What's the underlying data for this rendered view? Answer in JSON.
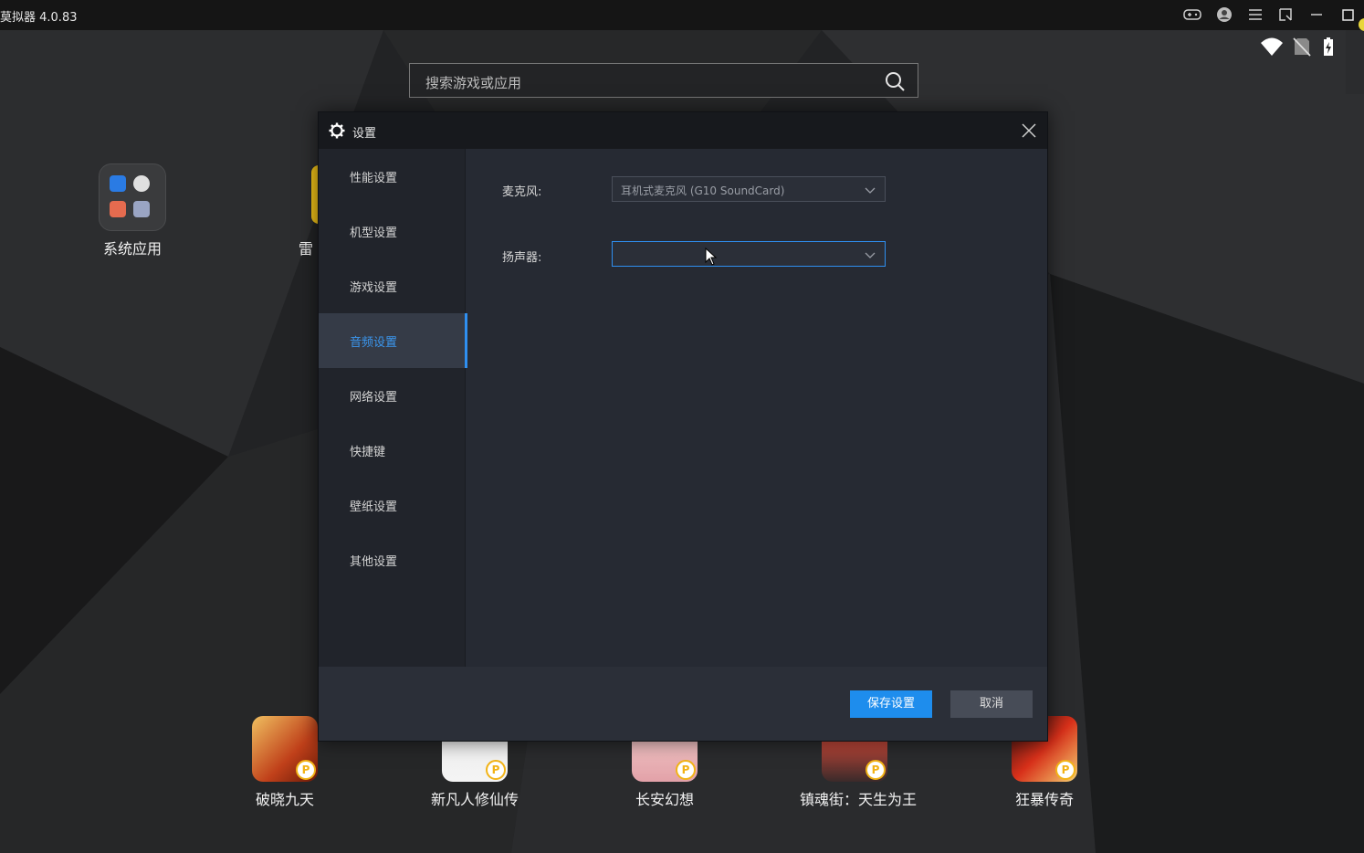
{
  "window": {
    "title": "模拟器 4.0.83",
    "title_visible": "莫拟器 4.0.83"
  },
  "search": {
    "placeholder": "搜索游戏或应用"
  },
  "desktop": {
    "system_apps_label": "系统应用",
    "partial_app_label": "雷",
    "games": [
      {
        "label": "破晓九天"
      },
      {
        "label": "新凡人修仙传"
      },
      {
        "label": "长安幻想"
      },
      {
        "label": "镇魂街：天生为王"
      },
      {
        "label": "狂暴传奇"
      }
    ]
  },
  "dialog": {
    "title": "设置",
    "nav": [
      {
        "label": "性能设置"
      },
      {
        "label": "机型设置"
      },
      {
        "label": "游戏设置"
      },
      {
        "label": "音频设置",
        "active": true
      },
      {
        "label": "网络设置"
      },
      {
        "label": "快捷键"
      },
      {
        "label": "壁纸设置"
      },
      {
        "label": "其他设置"
      }
    ],
    "microphone": {
      "label": "麦克风:",
      "value": "耳机式麦克风 (G10 SoundCard)"
    },
    "speaker": {
      "label": "扬声器:",
      "value": ""
    },
    "save_label": "保存设置",
    "cancel_label": "取消"
  },
  "colors": {
    "accent": "#1e8ded",
    "active_text": "#3b97ef",
    "dialog_bg": "#262a33"
  }
}
